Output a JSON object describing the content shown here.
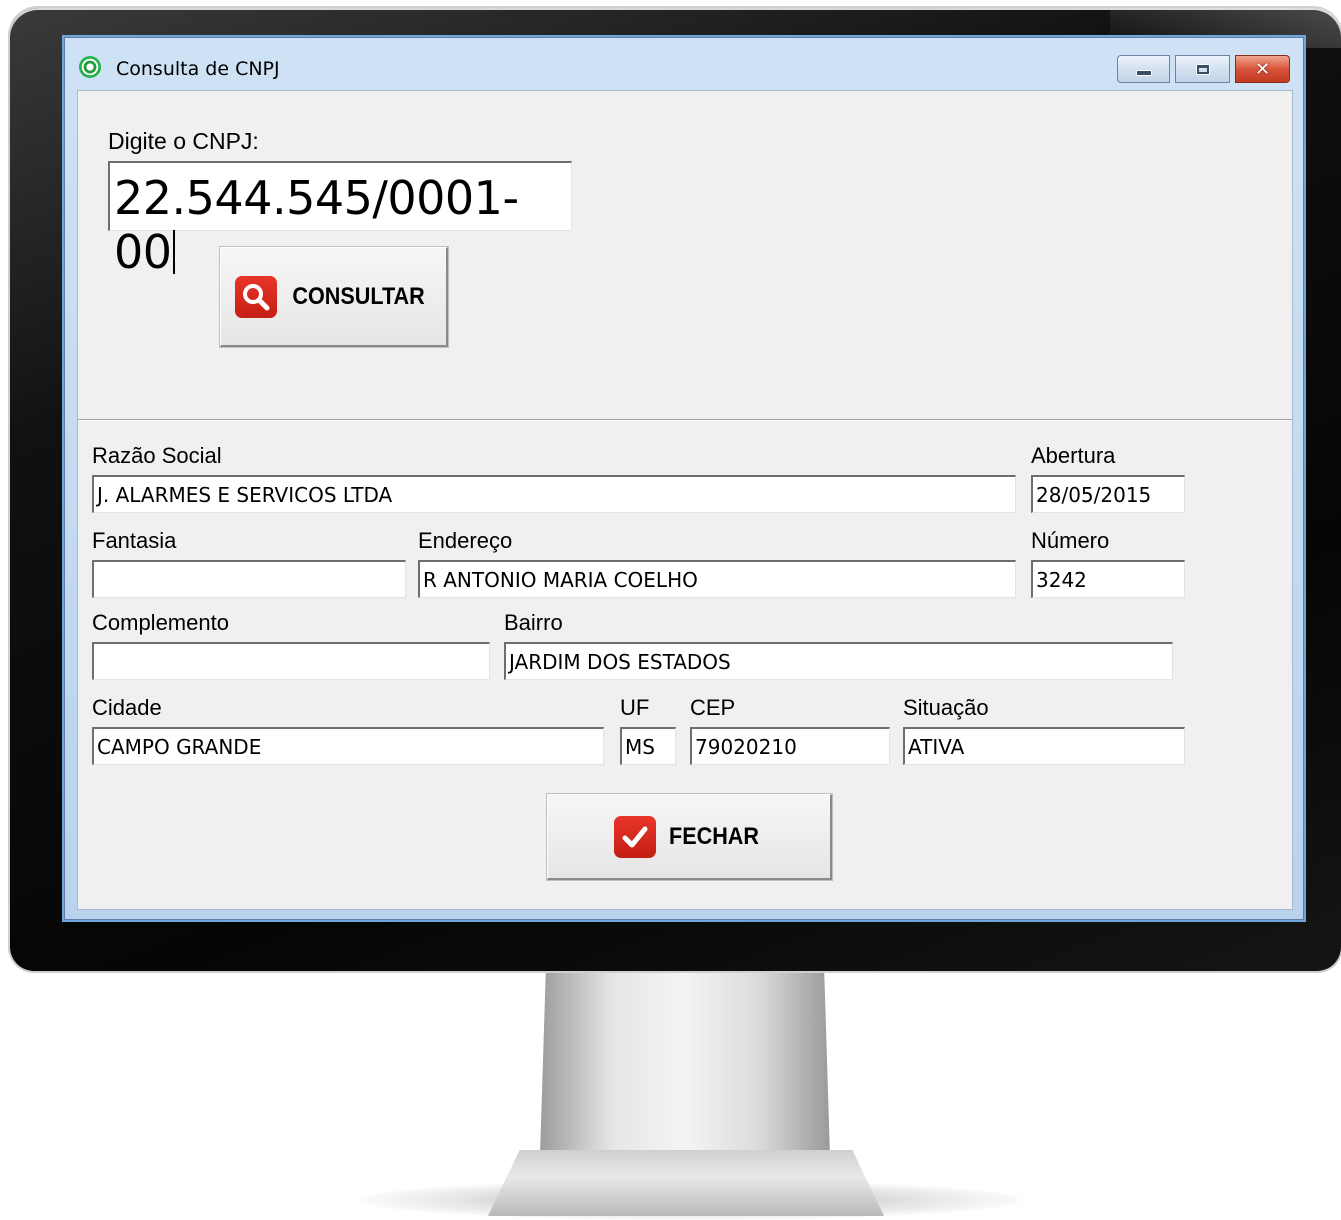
{
  "window": {
    "title": "Consulta de CNPJ",
    "close_glyph": "✕"
  },
  "search": {
    "label": "Digite o CNPJ:",
    "value": "22.544.545/0001-00",
    "button_label": "CONSULTAR",
    "button_icon": "magnifier-icon"
  },
  "fields": {
    "razao_social": {
      "label": "Razão Social",
      "value": "J. ALARMES E SERVICOS LTDA"
    },
    "abertura": {
      "label": "Abertura",
      "value": "28/05/2015"
    },
    "fantasia": {
      "label": "Fantasia",
      "value": ""
    },
    "endereco": {
      "label": "Endereço",
      "value": "R ANTONIO MARIA COELHO"
    },
    "numero": {
      "label": "Número",
      "value": "3242"
    },
    "complemento": {
      "label": "Complemento",
      "value": ""
    },
    "bairro": {
      "label": "Bairro",
      "value": "JARDIM DOS ESTADOS"
    },
    "cidade": {
      "label": "Cidade",
      "value": "CAMPO GRANDE"
    },
    "uf": {
      "label": "UF",
      "value": "MS"
    },
    "cep": {
      "label": "CEP",
      "value": "79020210"
    },
    "situacao": {
      "label": "Situação",
      "value": "ATIVA"
    }
  },
  "footer": {
    "close_button_label": "FECHAR",
    "close_button_icon": "checkmark-icon"
  },
  "colors": {
    "accent_red": "#d42a1f",
    "titlebar_blue": "#b9d3ee",
    "client_bg": "#f0f0f0"
  }
}
